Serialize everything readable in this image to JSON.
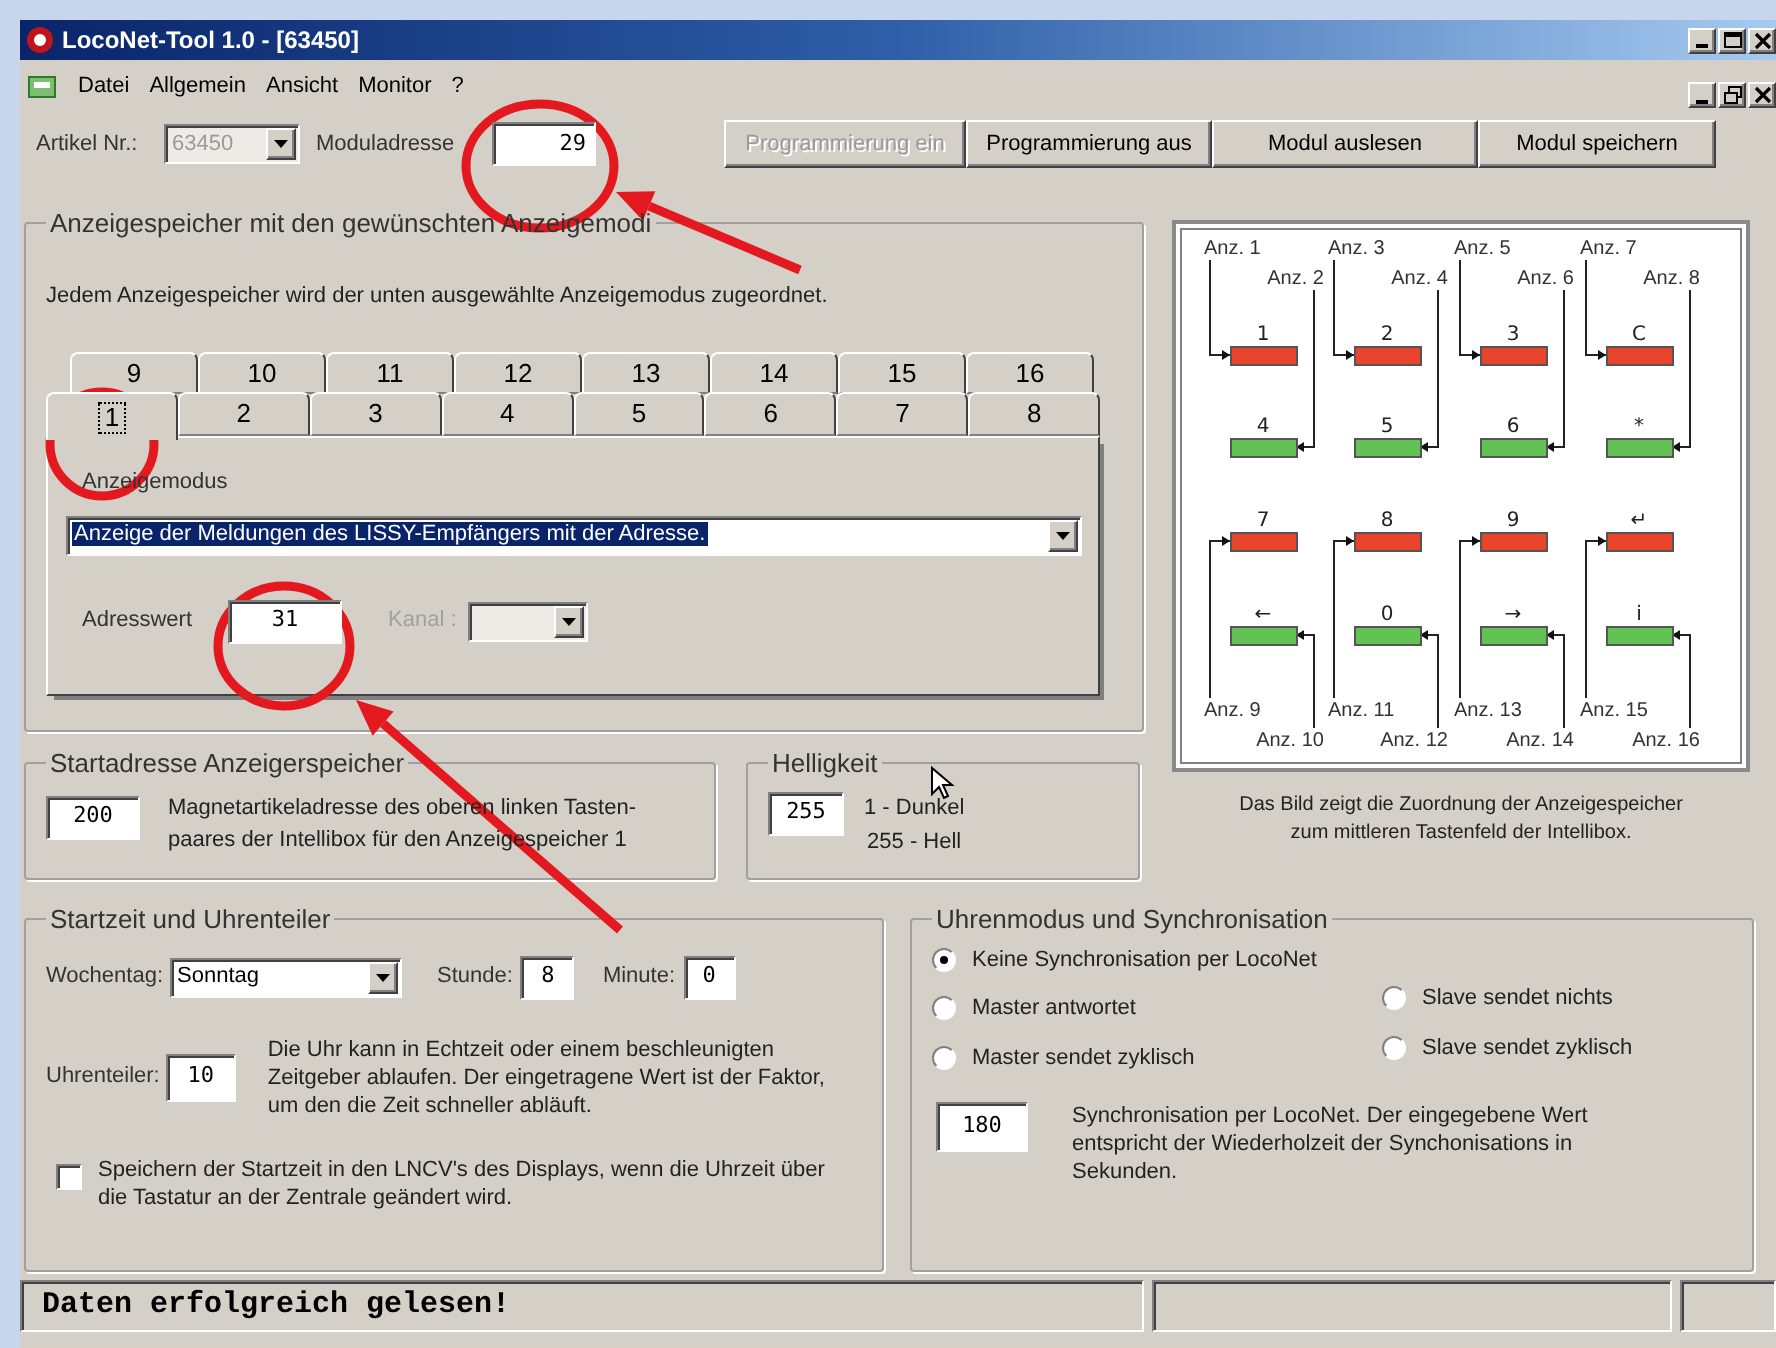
{
  "window": {
    "title": "LocoNet-Tool 1.0 - [63450]"
  },
  "menu": [
    "Datei",
    "Allgemein",
    "Ansicht",
    "Monitor",
    "?"
  ],
  "toolbar": {
    "article_label": "Artikel Nr.:",
    "article_value": "63450",
    "article_disabled": true,
    "module_address_label": "Moduladresse",
    "module_address": "29",
    "buttons": [
      {
        "label": "Programmierung ein",
        "disabled": true
      },
      {
        "label": "Programmierung aus",
        "disabled": false
      },
      {
        "label": "Modul auslesen",
        "disabled": false
      },
      {
        "label": "Modul speichern",
        "disabled": false
      }
    ]
  },
  "display_memory": {
    "title": "Anzeigespeicher mit den gewünschten Anzeigemodi",
    "description": "Jedem Anzeigespeicher wird der unten ausgewählte Anzeigemodus zugeordnet.",
    "tab_rows": [
      {
        "tabs": [
          {
            "label": "9",
            "selected": false
          },
          {
            "label": "10",
            "selected": false
          },
          {
            "label": "11",
            "selected": false
          },
          {
            "label": "12",
            "selected": false
          },
          {
            "label": "13",
            "selected": false
          },
          {
            "label": "14",
            "selected": false
          },
          {
            "label": "15",
            "selected": false
          },
          {
            "label": "16",
            "selected": false
          }
        ]
      },
      {
        "tabs": [
          {
            "label": "1",
            "selected": true
          },
          {
            "label": "2",
            "selected": false
          },
          {
            "label": "3",
            "selected": false
          },
          {
            "label": "4",
            "selected": false
          },
          {
            "label": "5",
            "selected": false
          },
          {
            "label": "6",
            "selected": false
          },
          {
            "label": "7",
            "selected": false
          },
          {
            "label": "8",
            "selected": false
          }
        ]
      }
    ],
    "mode_label": "Anzeigemodus",
    "mode_value": "Anzeige der Meldungen des LISSY-Empfängers mit der Adresse.",
    "address_label": "Adresswert",
    "address_value": "31",
    "channel_label": "Kanal :",
    "channel_disabled": true
  },
  "diagram": {
    "top_labels": [
      "Anz. 1",
      "Anz. 2",
      "Anz. 3",
      "Anz. 4",
      "Anz. 5",
      "Anz. 6",
      "Anz. 7",
      "Anz. 8"
    ],
    "keys": [
      {
        "label": "1",
        "color": "#e8452c"
      },
      {
        "label": "2",
        "color": "#e8452c"
      },
      {
        "label": "3",
        "color": "#e8452c"
      },
      {
        "label": "C",
        "color": "#e8452c"
      },
      {
        "label": "4",
        "color": "#62c254"
      },
      {
        "label": "5",
        "color": "#62c254"
      },
      {
        "label": "6",
        "color": "#62c254"
      },
      {
        "label": "*",
        "color": "#62c254"
      },
      {
        "label": "7",
        "color": "#e8452c"
      },
      {
        "label": "8",
        "color": "#e8452c"
      },
      {
        "label": "9",
        "color": "#e8452c"
      },
      {
        "label": "↵",
        "color": "#e8452c"
      },
      {
        "label": "←",
        "color": "#62c254"
      },
      {
        "label": "0",
        "color": "#62c254"
      },
      {
        "label": "→",
        "color": "#62c254"
      },
      {
        "label": "i",
        "color": "#62c254"
      }
    ],
    "bottom_labels": [
      "Anz. 9",
      "Anz. 10",
      "Anz. 11",
      "Anz. 12",
      "Anz. 13",
      "Anz. 14",
      "Anz. 15",
      "Anz. 16"
    ],
    "caption_lines": [
      "Das Bild zeigt die Zuordnung der Anzeigespeicher",
      "zum mittleren Tastenfeld der Intellibox."
    ]
  },
  "start_address": {
    "title": "Startadresse Anzeigerspeicher",
    "value": "200",
    "description_lines": [
      "Magnetartikeladresse des oberen linken Tasten-",
      "paares der Intellibox für den Anzeigespeicher 1"
    ]
  },
  "brightness": {
    "title": "Helligkeit",
    "value": "255",
    "lines": [
      "1 - Dunkel",
      "255 - Hell"
    ]
  },
  "start_time": {
    "title": "Startzeit und Uhrenteiler",
    "weekday_label": "Wochentag:",
    "weekday": "Sonntag",
    "hour_label": "Stunde:",
    "hour": "8",
    "minute_label": "Minute:",
    "minute": "0",
    "divider_label": "Uhrenteiler:",
    "divider": "10",
    "divider_note": "Die Uhr kann in Echtzeit oder einem beschleunigten Zeitgeber ablaufen. Der eingetragene Wert ist der Faktor, um den die Zeit schneller abläuft.",
    "save_option": {
      "label": "Speichern der Startzeit in den LNCV's des Displays, wenn die Uhrzeit über die Tastatur an der Zentrale geändert wird.",
      "checked": false
    }
  },
  "clock_mode": {
    "title": "Uhrenmodus und Synchronisation",
    "options": [
      {
        "label": "Keine Synchronisation per LocoNet",
        "selected": true
      },
      {
        "label": "Master antwortet",
        "selected": false
      },
      {
        "label": "Slave sendet nichts",
        "selected": false
      },
      {
        "label": "Master sendet zyklisch",
        "selected": false
      },
      {
        "label": "Slave sendet zyklisch",
        "selected": false
      }
    ],
    "interval": "180",
    "interval_note": "Synchronisation per LocoNet. Der eingegebene Wert entspricht der Wiederholzeit der Synchonisations in Sekunden."
  },
  "status_bar": {
    "message": "Daten erfolgreich gelesen!"
  }
}
